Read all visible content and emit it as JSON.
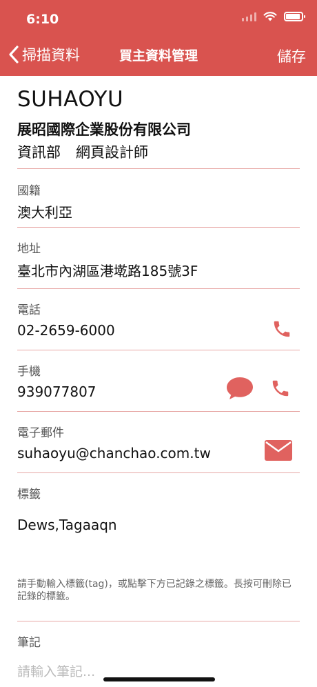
{
  "status_bar": {
    "time": "6:10"
  },
  "nav": {
    "back_label": "掃描資料",
    "title": "買主資料管理",
    "save_label": "儲存"
  },
  "profile": {
    "name": "SUHAOYU",
    "company": "展昭國際企業股份有限公司",
    "department": "資訊部",
    "title": "網頁設計師"
  },
  "fields": {
    "nationality": {
      "label": "國籍",
      "value": "澳大利亞"
    },
    "address": {
      "label": "地址",
      "value": "臺北市內湖區港墘路185號3F"
    },
    "phone": {
      "label": "電話",
      "value": "02-2659-6000"
    },
    "mobile": {
      "label": "手機",
      "value": "939077807"
    },
    "email": {
      "label": "電子郵件",
      "value": "suhaoyu@chanchao.com.tw"
    },
    "tags": {
      "label": "標籤",
      "value": "Dews,Tagaaqn",
      "hint": "請手動輸入標籤(tag)，或點擊下方已記錄之標籤。長按可刪除已記錄的標籤。"
    },
    "notes": {
      "label": "筆記",
      "placeholder": "請輸入筆記..."
    }
  },
  "icons": {
    "back": "chevron-left-icon",
    "phone": "phone-icon",
    "message": "speech-bubble-icon",
    "email": "envelope-icon",
    "wifi": "wifi-icon",
    "battery": "battery-icon",
    "signal": "cellular-signal-icon"
  },
  "colors": {
    "accent": "#d9534f",
    "icon": "#e0625f",
    "divider": "#e7a6a4"
  }
}
